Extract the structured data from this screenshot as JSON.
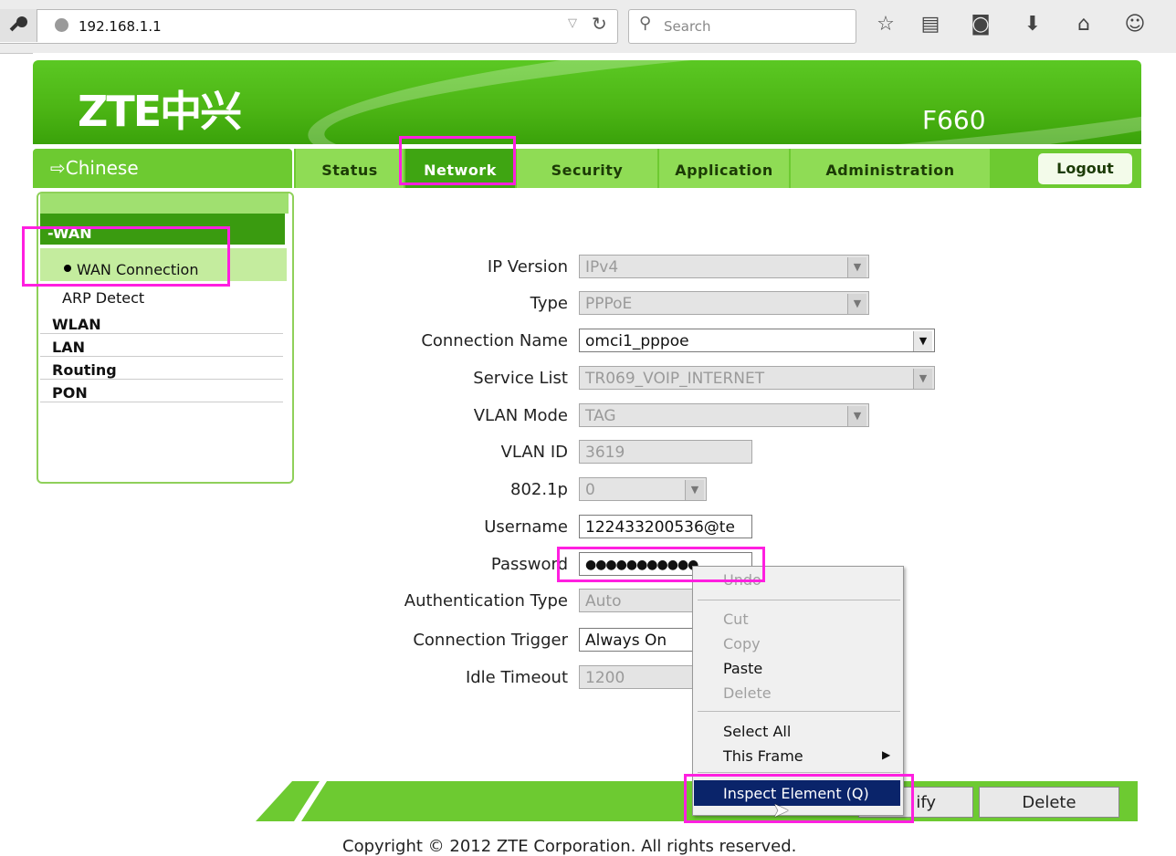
{
  "browser": {
    "url": "192.168.1.1",
    "search_placeholder": "Search",
    "icons": [
      "key-icon",
      "globe-icon",
      "star-icon",
      "reading-list-icon",
      "pocket-icon",
      "download-icon",
      "home-icon",
      "chat-icon"
    ]
  },
  "header": {
    "logo": "ZTE中兴",
    "model": "F660"
  },
  "lang_link": "⇨Chinese",
  "nav": {
    "tabs": [
      "Status",
      "Network",
      "Security",
      "Application",
      "Administration"
    ],
    "active": "Network",
    "logout": "Logout"
  },
  "sidebar": {
    "section": "-WAN",
    "items": [
      "WAN Connection",
      "ARP Detect"
    ],
    "categories": [
      "WLAN",
      "LAN",
      "Routing",
      "PON"
    ]
  },
  "form": {
    "rows": [
      {
        "label": "IP Version",
        "value": "IPv4"
      },
      {
        "label": "Type",
        "value": "PPPoE"
      },
      {
        "label": "Connection Name",
        "value": "omci1_pppoe"
      },
      {
        "label": "Service List",
        "value": "TR069_VOIP_INTERNET"
      },
      {
        "label": "VLAN Mode",
        "value": "TAG"
      },
      {
        "label": "VLAN ID",
        "value": "3619"
      },
      {
        "label": "802.1p",
        "value": "0"
      },
      {
        "label": "Username",
        "value": "122433200536@te"
      },
      {
        "label": "Password",
        "value": "●●●●●●●●●●●"
      },
      {
        "label": "Authentication Type",
        "value": "Auto"
      },
      {
        "label": "Connection Trigger",
        "value": "Always On"
      },
      {
        "label": "Idle Timeout",
        "value": "1200"
      }
    ]
  },
  "buttons": {
    "modify": "ify",
    "delete": "Delete"
  },
  "footer": "Copyright © 2012 ZTE Corporation. All rights reserved.",
  "context_menu": {
    "undo": "Undo",
    "cut": "Cut",
    "copy": "Copy",
    "paste": "Paste",
    "delete": "Delete",
    "select_all": "Select All",
    "this_frame": "This Frame",
    "inspect": "Inspect Element (Q)"
  },
  "highlight_color": "#ff1fe0",
  "brand_green": "#4db615"
}
